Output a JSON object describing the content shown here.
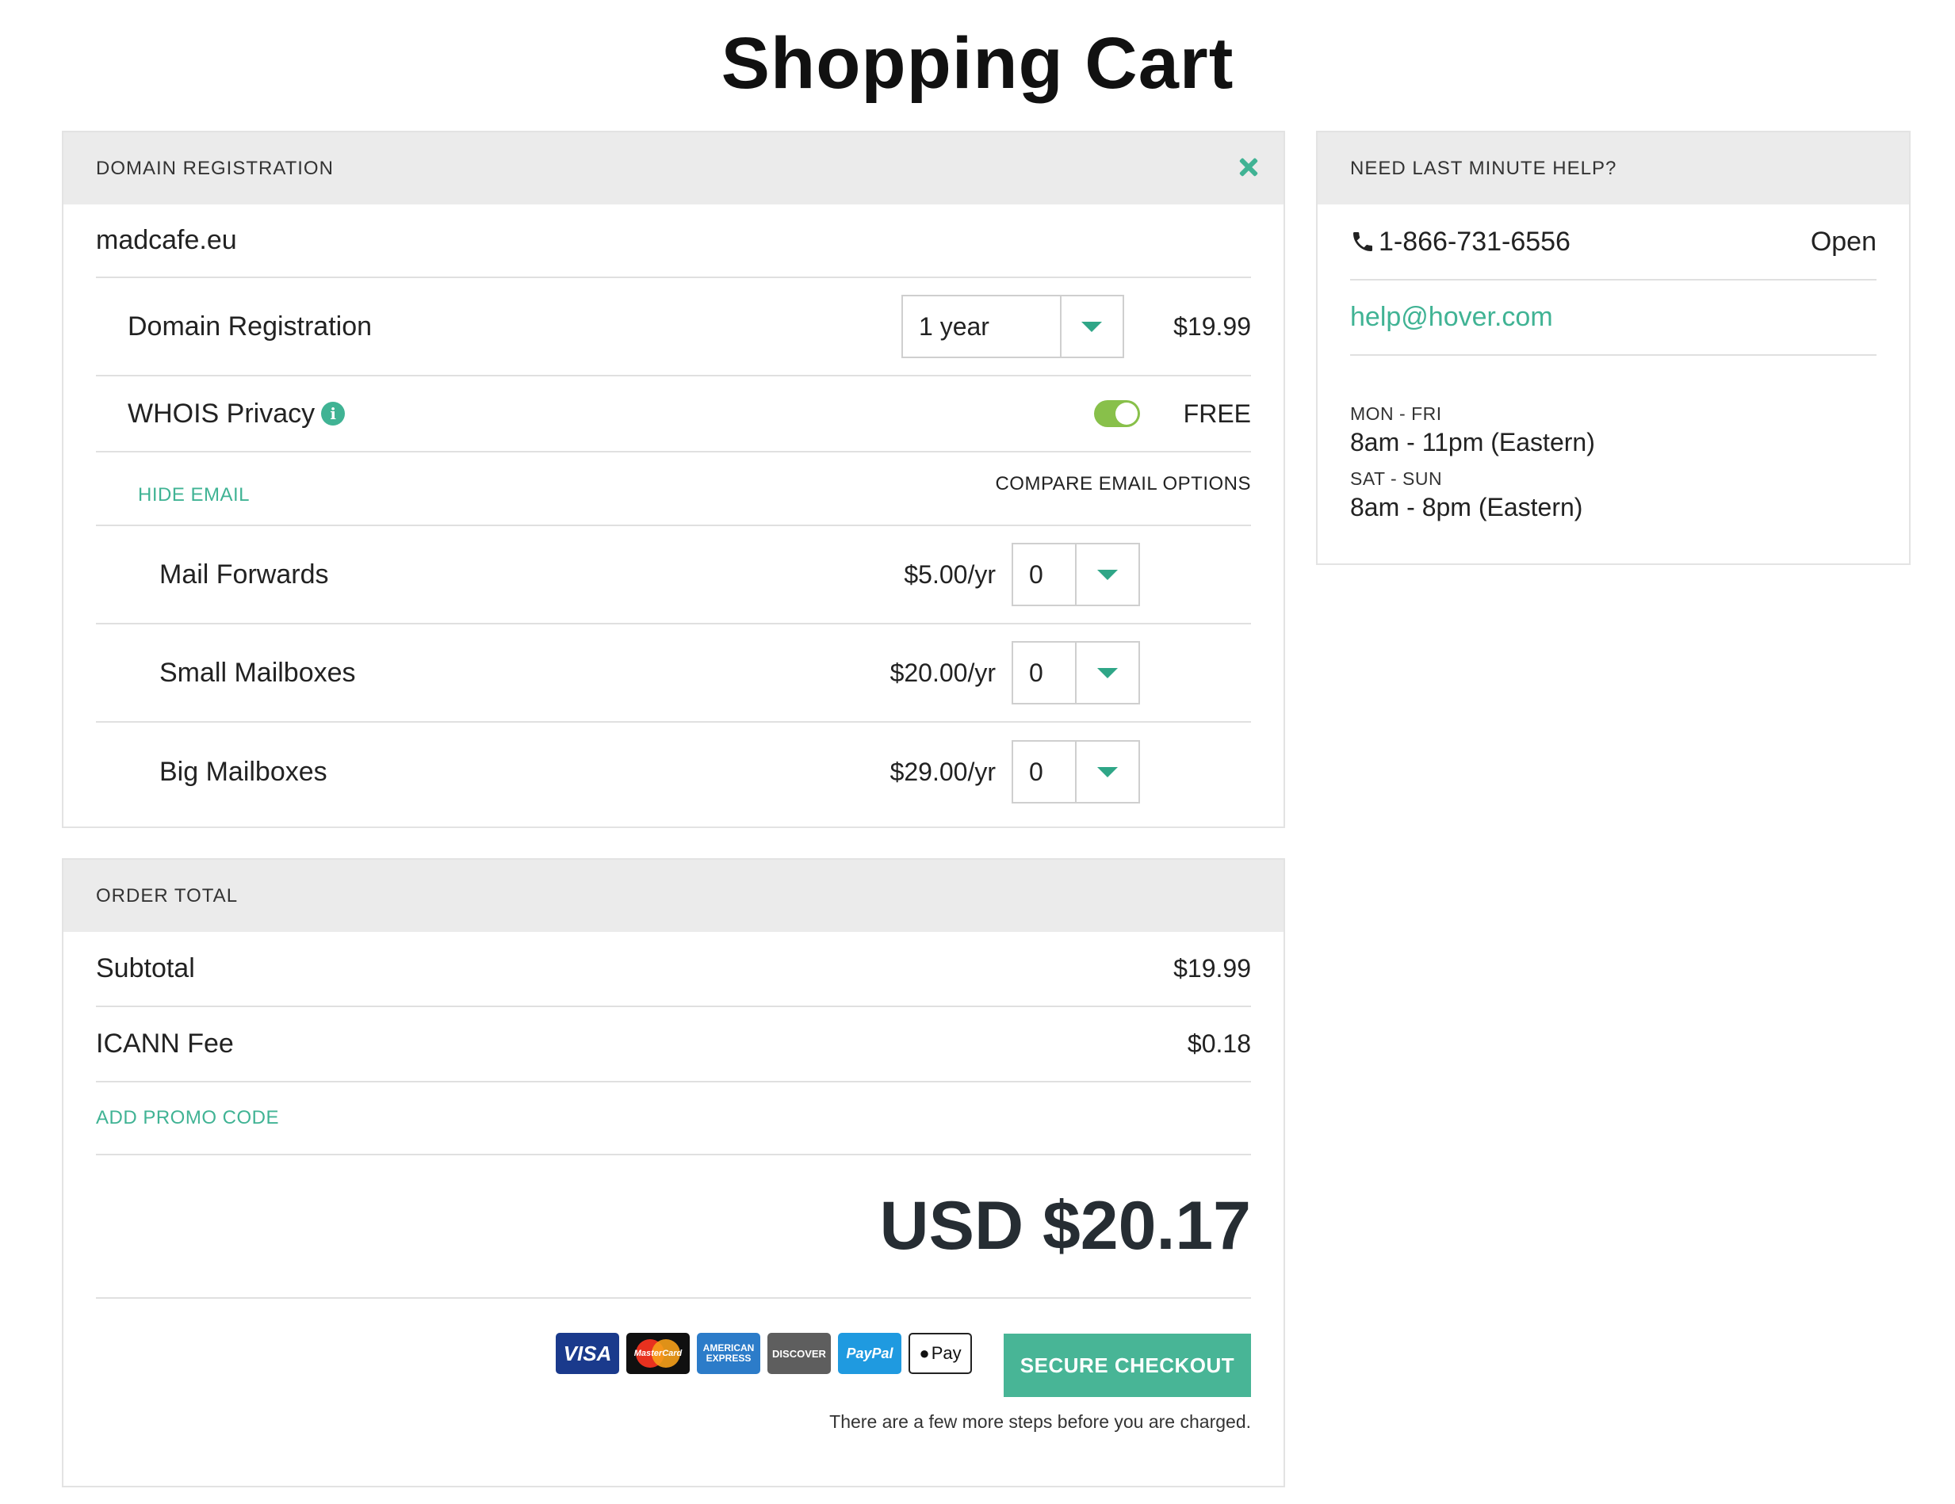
{
  "page_title": "Shopping Cart",
  "colors": {
    "accent": "#40b394",
    "toggle_on": "#88c04a",
    "header_bg": "#ebebeb",
    "button_bg": "#48b596"
  },
  "domain_panel": {
    "header": "DOMAIN REGISTRATION",
    "close_icon": "close-icon",
    "domain_name": "madcafe.eu",
    "registration": {
      "label": "Domain Registration",
      "term": "1 year",
      "price": "$19.99"
    },
    "whois": {
      "label": "WHOIS Privacy",
      "info_glyph": "i",
      "enabled": true,
      "price": "FREE"
    },
    "hide_email_link": "HIDE EMAIL",
    "compare_email_link": "COMPARE EMAIL OPTIONS",
    "mail_items": [
      {
        "label": "Mail Forwards",
        "price": "$5.00/yr",
        "qty": "0"
      },
      {
        "label": "Small Mailboxes",
        "price": "$20.00/yr",
        "qty": "0"
      },
      {
        "label": "Big Mailboxes",
        "price": "$29.00/yr",
        "qty": "0"
      }
    ]
  },
  "order_total": {
    "header": "ORDER TOTAL",
    "subtotal_label": "Subtotal",
    "subtotal_value": "$19.99",
    "fee_label": "ICANN Fee",
    "fee_value": "$0.18",
    "promo_link": "ADD PROMO CODE",
    "grand_total": "USD $20.17",
    "payment_cards": {
      "visa": "VISA",
      "mastercard": "MasterCard",
      "amex_line1": "AMERICAN",
      "amex_line2": "EXPRESS",
      "discover": "DISCOVER",
      "paypal": "PayPal",
      "applepay": "Pay"
    },
    "checkout_button": "SECURE CHECKOUT",
    "charge_note": "There are a few more steps before you are charged."
  },
  "help_panel": {
    "header": "NEED LAST MINUTE HELP?",
    "phone": "1-866-731-6556",
    "status": "Open",
    "email": "help@hover.com",
    "weekday_label": "MON - FRI",
    "weekday_hours": "8am - 11pm (Eastern)",
    "weekend_label": "SAT - SUN",
    "weekend_hours": "8am - 8pm (Eastern)"
  }
}
